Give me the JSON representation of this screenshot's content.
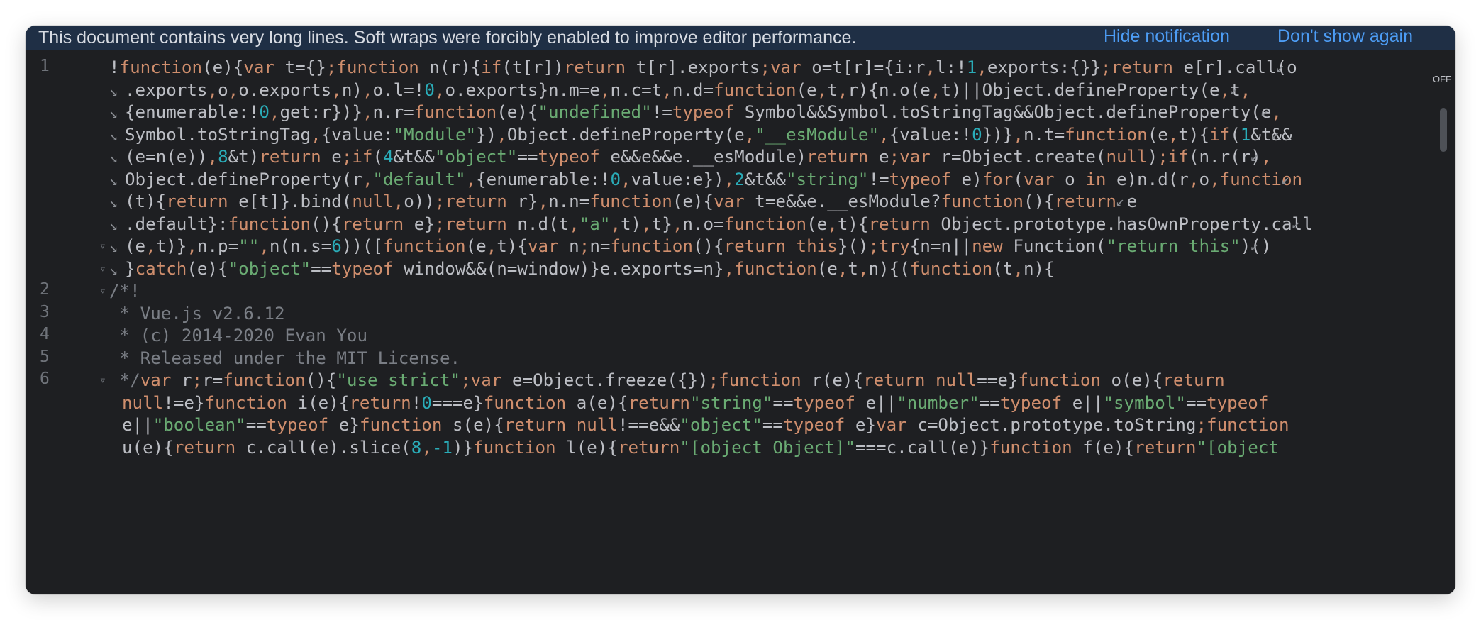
{
  "notification": {
    "message": "This document contains very long lines. Soft wraps were forcibly enabled to improve editor performance.",
    "hide_label": "Hide notification",
    "dont_show_label": "Don't show again"
  },
  "editor": {
    "off_label": "OFF",
    "line_numbers": [
      "1",
      "2",
      "3",
      "4",
      "5",
      "6"
    ],
    "lines": [
      [
        [
          "p",
          "!"
        ],
        [
          "k",
          "function"
        ],
        [
          "p",
          "(e){"
        ],
        [
          "k",
          "var"
        ],
        [
          "p",
          " t={}"
        ],
        [
          "k",
          ";function"
        ],
        [
          "p",
          " n(r){"
        ],
        [
          "k",
          "if"
        ],
        [
          "p",
          "(t[r])"
        ],
        [
          "k",
          "return"
        ],
        [
          "p",
          " t[r].exports"
        ],
        [
          "k",
          ";var"
        ],
        [
          "p",
          " o=t[r]={i:r"
        ],
        [
          "k",
          ","
        ],
        [
          "p",
          "l:!"
        ],
        [
          "n",
          "1"
        ],
        [
          "k",
          ","
        ],
        [
          "p",
          "exports:{}}"
        ],
        [
          "k",
          ";return"
        ],
        [
          "p",
          " e[r].call(o"
        ]
      ],
      [
        [
          "p",
          ".exports"
        ],
        [
          "k",
          ","
        ],
        [
          "p",
          "o"
        ],
        [
          "k",
          ","
        ],
        [
          "p",
          "o.exports"
        ],
        [
          "k",
          ","
        ],
        [
          "p",
          "n)"
        ],
        [
          "k",
          ","
        ],
        [
          "p",
          "o.l=!"
        ],
        [
          "n",
          "0"
        ],
        [
          "k",
          ","
        ],
        [
          "p",
          "o.exports}n.m=e"
        ],
        [
          "k",
          ","
        ],
        [
          "p",
          "n.c=t"
        ],
        [
          "k",
          ","
        ],
        [
          "p",
          "n.d="
        ],
        [
          "k",
          "function"
        ],
        [
          "p",
          "(e"
        ],
        [
          "k",
          ","
        ],
        [
          "p",
          "t"
        ],
        [
          "k",
          ","
        ],
        [
          "p",
          "r){n.o(e"
        ],
        [
          "k",
          ","
        ],
        [
          "p",
          "t)||Object.defineProperty(e"
        ],
        [
          "k",
          ","
        ],
        [
          "p",
          "t"
        ],
        [
          "k",
          ","
        ]
      ],
      [
        [
          "p",
          "{enumerable:!"
        ],
        [
          "n",
          "0"
        ],
        [
          "k",
          ","
        ],
        [
          "p",
          "get:r})}"
        ],
        [
          "k",
          ","
        ],
        [
          "p",
          "n.r="
        ],
        [
          "k",
          "function"
        ],
        [
          "p",
          "(e){"
        ],
        [
          "s",
          "\"undefined\""
        ],
        [
          "p",
          "!="
        ],
        [
          "k",
          "typeof"
        ],
        [
          "p",
          " Symbol&&Symbol.toStringTag&&Object.defineProperty(e"
        ],
        [
          "k",
          ","
        ]
      ],
      [
        [
          "p",
          "Symbol.toStringTag"
        ],
        [
          "k",
          ","
        ],
        [
          "p",
          "{value:"
        ],
        [
          "s",
          "\"Module\""
        ],
        [
          "p",
          "})"
        ],
        [
          "k",
          ","
        ],
        [
          "p",
          "Object.defineProperty(e"
        ],
        [
          "k",
          ","
        ],
        [
          "s",
          "\"__esModule\""
        ],
        [
          "k",
          ","
        ],
        [
          "p",
          "{value:!"
        ],
        [
          "n",
          "0"
        ],
        [
          "p",
          "})}"
        ],
        [
          "k",
          ","
        ],
        [
          "p",
          "n.t="
        ],
        [
          "k",
          "function"
        ],
        [
          "p",
          "(e"
        ],
        [
          "k",
          ","
        ],
        [
          "p",
          "t){"
        ],
        [
          "k",
          "if"
        ],
        [
          "p",
          "("
        ],
        [
          "n",
          "1"
        ],
        [
          "p",
          "&t&&"
        ]
      ],
      [
        [
          "p",
          "(e=n(e))"
        ],
        [
          "k",
          ","
        ],
        [
          "n",
          "8"
        ],
        [
          "p",
          "&t)"
        ],
        [
          "k",
          "return"
        ],
        [
          "p",
          " e"
        ],
        [
          "k",
          ";if"
        ],
        [
          "p",
          "("
        ],
        [
          "n",
          "4"
        ],
        [
          "p",
          "&t&&"
        ],
        [
          "s",
          "\"object\""
        ],
        [
          "p",
          "=="
        ],
        [
          "k",
          "typeof"
        ],
        [
          "p",
          " e&&e&&e.__esModule)"
        ],
        [
          "k",
          "return"
        ],
        [
          "p",
          " e"
        ],
        [
          "k",
          ";var"
        ],
        [
          "p",
          " r=Object.create("
        ],
        [
          "k",
          "null"
        ],
        [
          "p",
          ")"
        ],
        [
          "k",
          ";if"
        ],
        [
          "p",
          "(n.r(r)"
        ],
        [
          "k",
          ","
        ]
      ],
      [
        [
          "p",
          "Object.defineProperty(r"
        ],
        [
          "k",
          ","
        ],
        [
          "s",
          "\"default\""
        ],
        [
          "k",
          ","
        ],
        [
          "p",
          "{enumerable:!"
        ],
        [
          "n",
          "0"
        ],
        [
          "k",
          ","
        ],
        [
          "p",
          "value:e})"
        ],
        [
          "k",
          ","
        ],
        [
          "n",
          "2"
        ],
        [
          "p",
          "&t&&"
        ],
        [
          "s",
          "\"string\""
        ],
        [
          "p",
          "!="
        ],
        [
          "k",
          "typeof"
        ],
        [
          "p",
          " e)"
        ],
        [
          "k",
          "for"
        ],
        [
          "p",
          "("
        ],
        [
          "k",
          "var"
        ],
        [
          "p",
          " o "
        ],
        [
          "k",
          "in"
        ],
        [
          "p",
          " e)n.d(r"
        ],
        [
          "k",
          ","
        ],
        [
          "p",
          "o"
        ],
        [
          "k",
          ","
        ],
        [
          "k",
          "function"
        ]
      ],
      [
        [
          "p",
          "(t){"
        ],
        [
          "k",
          "return"
        ],
        [
          "p",
          " e[t]}.bind("
        ],
        [
          "k",
          "null"
        ],
        [
          "k",
          ","
        ],
        [
          "p",
          "o))"
        ],
        [
          "k",
          ";return"
        ],
        [
          "p",
          " r}"
        ],
        [
          "k",
          ","
        ],
        [
          "p",
          "n.n="
        ],
        [
          "k",
          "function"
        ],
        [
          "p",
          "(e){"
        ],
        [
          "k",
          "var"
        ],
        [
          "p",
          " t=e&&e.__esModule?"
        ],
        [
          "k",
          "function"
        ],
        [
          "p",
          "(){"
        ],
        [
          "k",
          "return"
        ],
        [
          "p",
          " e"
        ]
      ],
      [
        [
          "p",
          ".default}:"
        ],
        [
          "k",
          "function"
        ],
        [
          "p",
          "(){"
        ],
        [
          "k",
          "return"
        ],
        [
          "p",
          " e}"
        ],
        [
          "k",
          ";return"
        ],
        [
          "p",
          " n.d(t"
        ],
        [
          "k",
          ","
        ],
        [
          "s",
          "\"a\""
        ],
        [
          "k",
          ","
        ],
        [
          "p",
          "t)"
        ],
        [
          "k",
          ","
        ],
        [
          "p",
          "t}"
        ],
        [
          "k",
          ","
        ],
        [
          "p",
          "n.o="
        ],
        [
          "k",
          "function"
        ],
        [
          "p",
          "(e"
        ],
        [
          "k",
          ","
        ],
        [
          "p",
          "t){"
        ],
        [
          "k",
          "return"
        ],
        [
          "p",
          " Object.prototype.hasOwnProperty.call"
        ]
      ],
      [
        [
          "p",
          "(e"
        ],
        [
          "k",
          ","
        ],
        [
          "p",
          "t)}"
        ],
        [
          "k",
          ","
        ],
        [
          "p",
          "n.p="
        ],
        [
          "s",
          "\"\""
        ],
        [
          "k",
          ","
        ],
        [
          "p",
          "n(n.s="
        ],
        [
          "n",
          "6"
        ],
        [
          "p",
          "))(["
        ],
        [
          "k",
          "function"
        ],
        [
          "p",
          "(e"
        ],
        [
          "k",
          ","
        ],
        [
          "p",
          "t){"
        ],
        [
          "k",
          "var"
        ],
        [
          "p",
          " n"
        ],
        [
          "k",
          ";"
        ],
        [
          "p",
          "n="
        ],
        [
          "k",
          "function"
        ],
        [
          "p",
          "(){"
        ],
        [
          "k",
          "return this"
        ],
        [
          "p",
          "}()"
        ],
        [
          "k",
          ";try"
        ],
        [
          "p",
          "{n=n||"
        ],
        [
          "k",
          "new"
        ],
        [
          "p",
          " Function("
        ],
        [
          "s",
          "\"return this\""
        ],
        [
          "p",
          ")()"
        ]
      ],
      [
        [
          "p",
          "}"
        ],
        [
          "k",
          "catch"
        ],
        [
          "p",
          "(e){"
        ],
        [
          "s",
          "\"object\""
        ],
        [
          "p",
          "=="
        ],
        [
          "k",
          "typeof"
        ],
        [
          "p",
          " window&&(n=window)}e.exports=n}"
        ],
        [
          "k",
          ","
        ],
        [
          "k",
          "function"
        ],
        [
          "p",
          "(e"
        ],
        [
          "k",
          ","
        ],
        [
          "p",
          "t"
        ],
        [
          "k",
          ","
        ],
        [
          "p",
          "n){("
        ],
        [
          "k",
          "function"
        ],
        [
          "p",
          "(t"
        ],
        [
          "k",
          ","
        ],
        [
          "p",
          "n){"
        ]
      ],
      [
        [
          "c",
          "/*!"
        ]
      ],
      [
        [
          "c",
          " * Vue.js v2.6.12"
        ]
      ],
      [
        [
          "c",
          " * (c) 2014-2020 Evan You"
        ]
      ],
      [
        [
          "c",
          " * Released under the MIT License."
        ]
      ],
      [
        [
          "c",
          " */"
        ],
        [
          "k",
          "var"
        ],
        [
          "p",
          " r"
        ],
        [
          "k",
          ";"
        ],
        [
          "p",
          "r="
        ],
        [
          "k",
          "function"
        ],
        [
          "p",
          "(){"
        ],
        [
          "s",
          "\"use strict\""
        ],
        [
          "k",
          ";var"
        ],
        [
          "p",
          " e=Object.freeze({})"
        ],
        [
          "k",
          ";function"
        ],
        [
          "p",
          " r(e){"
        ],
        [
          "k",
          "return null"
        ],
        [
          "p",
          "==e}"
        ],
        [
          "k",
          "function"
        ],
        [
          "p",
          " o(e){"
        ],
        [
          "k",
          "return"
        ]
      ],
      [
        [
          "k",
          "null"
        ],
        [
          "p",
          "!=e}"
        ],
        [
          "k",
          "function"
        ],
        [
          "p",
          " i(e){"
        ],
        [
          "k",
          "return"
        ],
        [
          "p",
          "!"
        ],
        [
          "n",
          "0"
        ],
        [
          "p",
          "===e}"
        ],
        [
          "k",
          "function"
        ],
        [
          "p",
          " a(e){"
        ],
        [
          "k",
          "return"
        ],
        [
          "s",
          "\"string\""
        ],
        [
          "p",
          "=="
        ],
        [
          "k",
          "typeof"
        ],
        [
          "p",
          " e||"
        ],
        [
          "s",
          "\"number\""
        ],
        [
          "p",
          "=="
        ],
        [
          "k",
          "typeof"
        ],
        [
          "p",
          " e||"
        ],
        [
          "s",
          "\"symbol\""
        ],
        [
          "p",
          "=="
        ],
        [
          "k",
          "typeof"
        ]
      ],
      [
        [
          "p",
          "e||"
        ],
        [
          "s",
          "\"boolean\""
        ],
        [
          "p",
          "=="
        ],
        [
          "k",
          "typeof"
        ],
        [
          "p",
          " e}"
        ],
        [
          "k",
          "function"
        ],
        [
          "p",
          " s(e){"
        ],
        [
          "k",
          "return null"
        ],
        [
          "p",
          "!==e&&"
        ],
        [
          "s",
          "\"object\""
        ],
        [
          "p",
          "=="
        ],
        [
          "k",
          "typeof"
        ],
        [
          "p",
          " e}"
        ],
        [
          "k",
          "var"
        ],
        [
          "p",
          " c=Object.prototype.toString"
        ],
        [
          "k",
          ";function"
        ]
      ],
      [
        [
          "p",
          "u(e){"
        ],
        [
          "k",
          "return"
        ],
        [
          "p",
          " c.call(e).slice("
        ],
        [
          "n",
          "8"
        ],
        [
          "k",
          ","
        ],
        [
          "n",
          "-1"
        ],
        [
          "p",
          ")}"
        ],
        [
          "k",
          "function"
        ],
        [
          "p",
          " l(e){"
        ],
        [
          "k",
          "return"
        ],
        [
          "s",
          "\"[object Object]\""
        ],
        [
          "p",
          "===c.call(e)}"
        ],
        [
          "k",
          "function"
        ],
        [
          "p",
          " f(e){"
        ],
        [
          "k",
          "return"
        ],
        [
          "s",
          "\"[object"
        ]
      ]
    ]
  },
  "colors": {
    "keyword": "#cf8e6d",
    "string": "#6aab73",
    "number": "#2aacb8",
    "comment": "#7a7e85",
    "plain": "#bcbec4",
    "link": "#4d9df5",
    "notification_bg": "#1f2f45"
  }
}
